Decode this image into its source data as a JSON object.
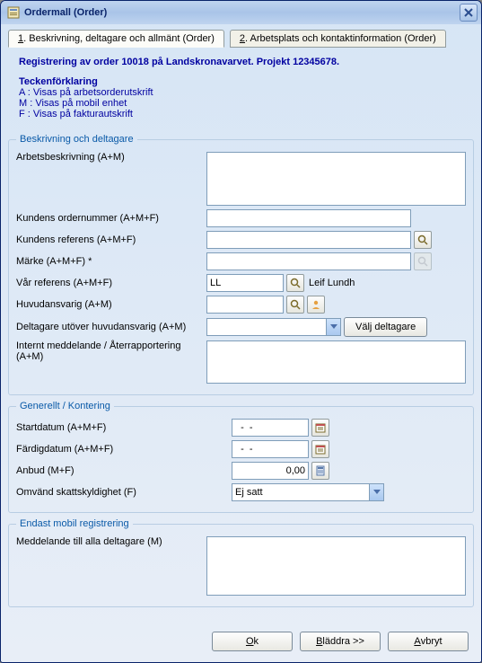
{
  "window": {
    "title": "Ordermall (Order)"
  },
  "tabs": {
    "tab1_num": "1",
    "tab1_label": ". Beskrivning, deltagare och allmänt (Order)",
    "tab2_num": "2",
    "tab2_label": ". Arbetsplats och kontaktinformation (Order)"
  },
  "info": {
    "registration": "Registrering av order 10018 på Landskronavarvet. Projekt 12345678.",
    "legend_title": "Teckenförklaring",
    "legend_a": "A : Visas på arbetsorderutskrift",
    "legend_m": "M : Visas på mobil enhet",
    "legend_f": "F : Visas på fakturautskrift"
  },
  "section1": {
    "legend": "Beskrivning och deltagare",
    "arbetsbeskrivning_label": "Arbetsbeskrivning (A+M)",
    "arbetsbeskrivning_value": "",
    "kundens_ordernr_label": "Kundens ordernummer (A+M+F)",
    "kundens_ordernr_value": "",
    "kundens_ref_label": "Kundens referens  (A+M+F)",
    "kundens_ref_value": "",
    "marke_label": "Märke (A+M+F) *",
    "marke_value": "",
    "var_ref_label": "Vår referens (A+M+F)",
    "var_ref_code": "LL",
    "var_ref_name": "Leif Lundh",
    "huvudansvarig_label": "Huvudansvarig (A+M)",
    "huvudansvarig_value": "",
    "deltagare_label": "Deltagare utöver huvudansvarig (A+M)",
    "valj_deltagare_btn": "Välj deltagare",
    "internt_label": "Internt meddelande / Återrapportering (A+M)",
    "internt_value": ""
  },
  "section2": {
    "legend": "Generellt / Kontering",
    "startdatum_label": "Startdatum (A+M+F)",
    "startdatum_value": "  -  -",
    "fardigdatum_label": "Färdigdatum (A+M+F)",
    "fardigdatum_value": "  -  -",
    "anbud_label": "Anbud (M+F)",
    "anbud_value": "0,00",
    "omvand_label": "Omvänd skattskyldighet (F)",
    "omvand_value": "Ej satt"
  },
  "section3": {
    "legend": "Endast mobil registrering",
    "meddelande_label": "Meddelande till alla deltagare (M)",
    "meddelande_value": ""
  },
  "footer": {
    "ok_u": "O",
    "ok_rest": "k",
    "bladdra_u": "B",
    "bladdra_rest": "läddra >>",
    "avbryt_u": "A",
    "avbryt_rest": "vbryt"
  }
}
